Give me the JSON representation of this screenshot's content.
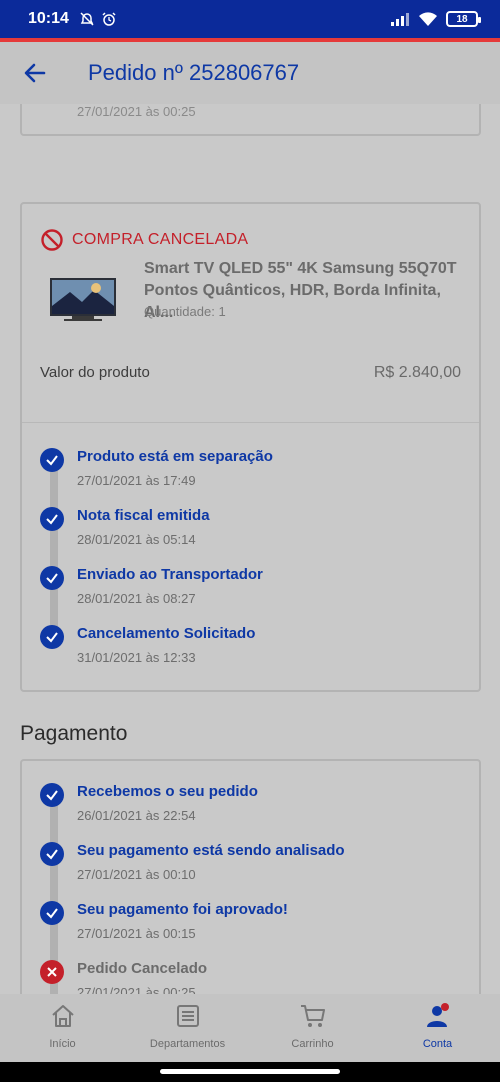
{
  "status_bar": {
    "time": "10:14",
    "battery": "18"
  },
  "header": {
    "title": "Pedido nº 252806767"
  },
  "previous_card": {
    "ghost_text": "27/01/2021 às 00:25"
  },
  "order": {
    "status_label": "COMPRA CANCELADA",
    "product_name_line1": "Smart TV QLED 55\" 4K Samsung 55Q70T",
    "product_name_line2": "Pontos Quânticos, HDR, Borda Infinita, Al...",
    "quantity": "Quantidade: 1",
    "price_label": "Valor do produto",
    "price_value": "R$ 2.840,00",
    "steps": [
      {
        "title": "Produto está em separação",
        "date": "27/01/2021 às 17:49"
      },
      {
        "title": "Nota fiscal emitida",
        "date": "28/01/2021 às 05:14"
      },
      {
        "title": "Enviado ao Transportador",
        "date": "28/01/2021 às 08:27"
      },
      {
        "title": "Cancelamento Solicitado",
        "date": "31/01/2021 às 12:33"
      }
    ]
  },
  "payment": {
    "section_title": "Pagamento",
    "steps": [
      {
        "title": "Recebemos o seu pedido",
        "date": "26/01/2021 às 22:54"
      },
      {
        "title": "Seu pagamento está sendo analisado",
        "date": "27/01/2021 às 00:10"
      },
      {
        "title": "Seu pagamento foi aprovado!",
        "date": "27/01/2021 às 00:15"
      },
      {
        "title": "Pedido Cancelado",
        "date": "27/01/2021 às 00:25"
      }
    ]
  },
  "bottom_nav": {
    "items": [
      {
        "label": "Início",
        "icon": "home-icon"
      },
      {
        "label": "Departamentos",
        "icon": "list-icon"
      },
      {
        "label": "Carrinho",
        "icon": "cart-icon"
      },
      {
        "label": "Conta",
        "icon": "user-icon"
      }
    ]
  },
  "colors": {
    "brand_blue": "#0e38a5",
    "status_bar": "#0b2a9a",
    "cancel_red": "#c4202a"
  }
}
